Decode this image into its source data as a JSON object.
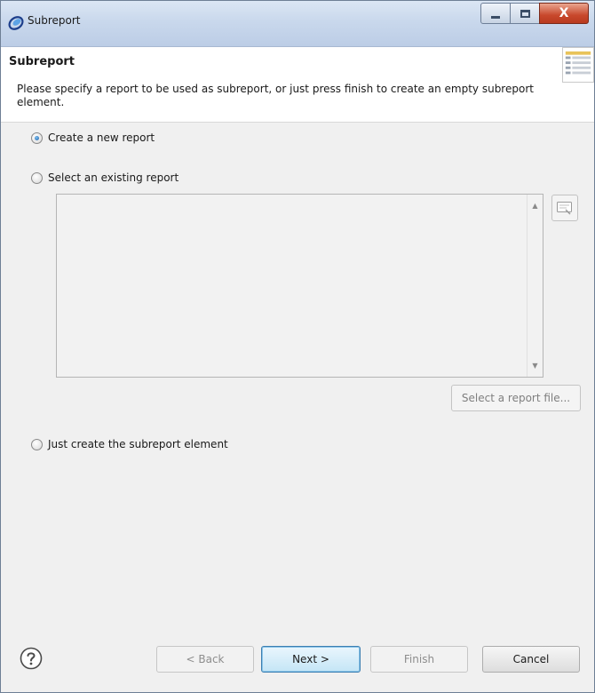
{
  "window": {
    "title": "Subreport",
    "close_glyph": "X"
  },
  "header": {
    "title": "Subreport",
    "description": "Please specify a report to be used as subreport, or just press finish to create an empty subreport element."
  },
  "options": {
    "create_new": "Create a new report",
    "select_existing": "Select an existing report",
    "just_create": "Just create the subreport element",
    "selected": "create_new"
  },
  "report_list": {
    "items": []
  },
  "buttons": {
    "select_file": "Select a report file...",
    "back": "< Back",
    "next": "Next >",
    "finish": "Finish",
    "cancel": "Cancel"
  },
  "icons": {
    "title": "eclipse-icon",
    "help": "help-icon",
    "side": "browse-workspace-icon",
    "header": "wizard-banner-icon"
  },
  "colors": {
    "default_button_border": "#3c7fb1",
    "close_button": "#c8482c",
    "radio_selected": "#1c5fa8"
  }
}
